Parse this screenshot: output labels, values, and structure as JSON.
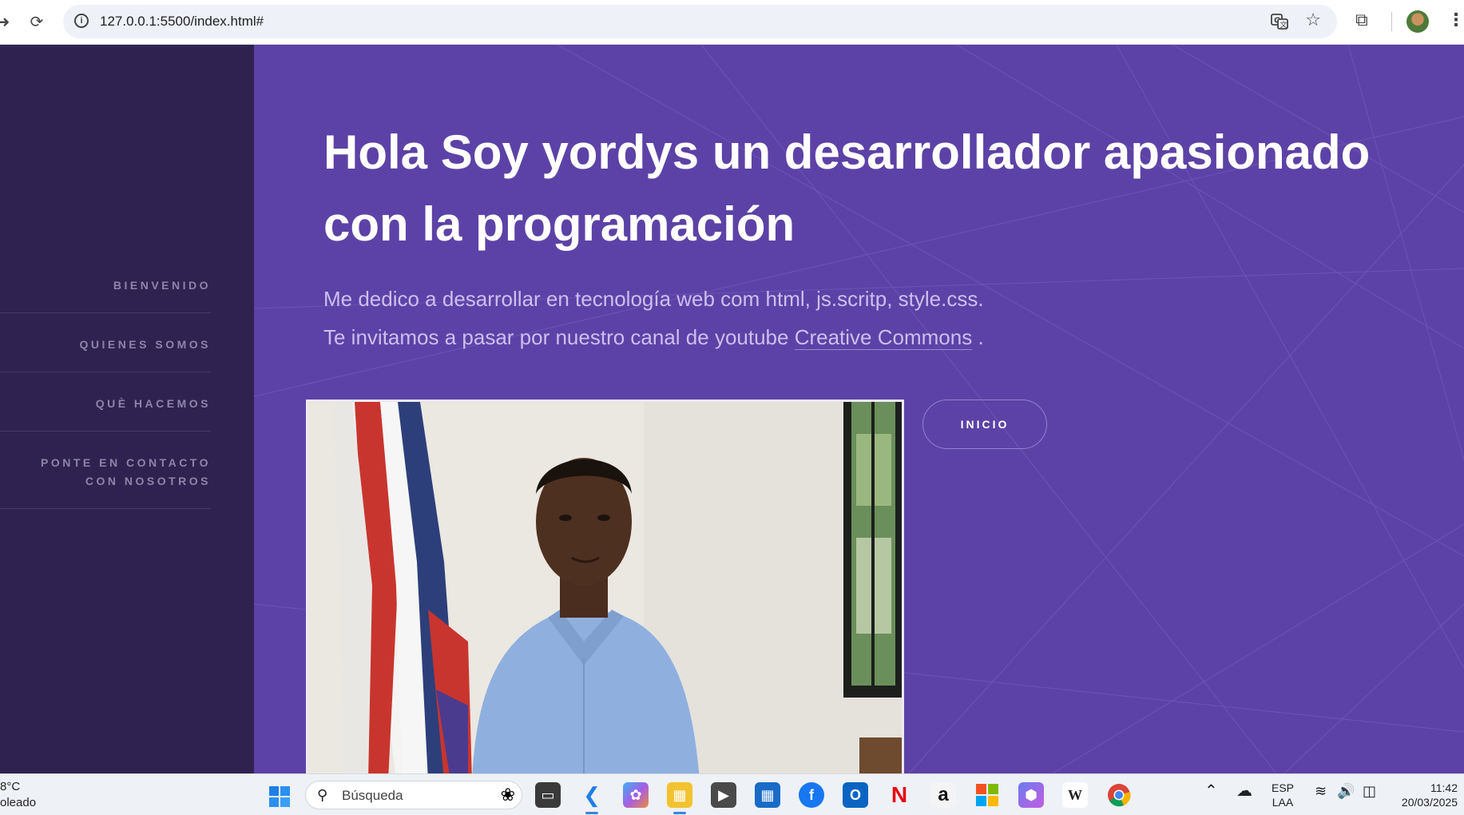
{
  "browser": {
    "url": "127.0.0.1:5500/index.html#"
  },
  "sidebar": {
    "items": [
      {
        "label": "BIENVENIDO"
      },
      {
        "label": "QUIENES SOMOS"
      },
      {
        "label": "QUÈ HACEMOS"
      },
      {
        "label": "PONTE EN CONTACTO CON NOSOTROS"
      }
    ]
  },
  "hero": {
    "headline": "Hola Soy yordys un desarrollador apasionado con la programación",
    "line1": "Me dedico a desarrollar en tecnología web com html, js.scritp, style.css.",
    "line2_prefix": "Te invitamos a pasar por nuestro canal de youtube",
    "link_label": "Creative Commons",
    "line2_suffix": ".",
    "button_label": "INICIO"
  },
  "taskbar": {
    "weather_temp": "8°C",
    "weather_desc": "oleado",
    "search_placeholder": "Búsqueda",
    "apps": [
      "file-explorer-dark",
      "vscode",
      "copilot",
      "file-explorer",
      "media-player",
      "microsoft-store",
      "facebook",
      "outlook",
      "netflix",
      "amazon",
      "microsoft-365",
      "copilot-app",
      "wikipedia",
      "chrome"
    ],
    "language_top": "ESP",
    "language_bottom": "LAA",
    "time": "11:42",
    "date": "20/03/2025"
  }
}
